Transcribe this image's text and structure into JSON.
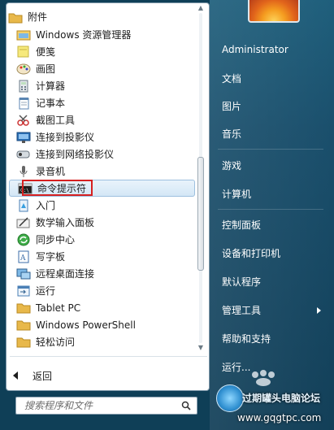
{
  "left_menu": {
    "items": [
      {
        "label": "附件",
        "icon": "folder-open-icon",
        "indent": false
      },
      {
        "label": "Windows 资源管理器",
        "icon": "explorer-icon",
        "indent": true
      },
      {
        "label": "便笺",
        "icon": "sticky-notes-icon",
        "indent": true
      },
      {
        "label": "画图",
        "icon": "paint-icon",
        "indent": true
      },
      {
        "label": "计算器",
        "icon": "calculator-icon",
        "indent": true
      },
      {
        "label": "记事本",
        "icon": "notepad-icon",
        "indent": true
      },
      {
        "label": "截图工具",
        "icon": "snipping-tool-icon",
        "indent": true
      },
      {
        "label": "连接到投影仪",
        "icon": "projector-icon",
        "indent": true
      },
      {
        "label": "连接到网络投影仪",
        "icon": "network-projector-icon",
        "indent": true
      },
      {
        "label": "录音机",
        "icon": "microphone-icon",
        "indent": true
      },
      {
        "label": "命令提示符",
        "icon": "cmd-icon",
        "indent": true,
        "selected": true
      },
      {
        "label": "入门",
        "icon": "getting-started-icon",
        "indent": true
      },
      {
        "label": "数学输入面板",
        "icon": "math-input-icon",
        "indent": true
      },
      {
        "label": "同步中心",
        "icon": "sync-center-icon",
        "indent": true
      },
      {
        "label": "写字板",
        "icon": "wordpad-icon",
        "indent": true
      },
      {
        "label": "远程桌面连接",
        "icon": "remote-desktop-icon",
        "indent": true
      },
      {
        "label": "运行",
        "icon": "run-icon",
        "indent": true
      },
      {
        "label": "Tablet PC",
        "icon": "folder-icon",
        "indent": true
      },
      {
        "label": "Windows PowerShell",
        "icon": "folder-icon",
        "indent": true
      },
      {
        "label": "轻松访问",
        "icon": "folder-icon",
        "indent": true
      }
    ],
    "back_label": "返回",
    "search_placeholder": "搜索程序和文件"
  },
  "right_menu": {
    "user_name": "Administrator",
    "items": [
      {
        "label": "文档"
      },
      {
        "label": "图片"
      },
      {
        "label": "音乐"
      },
      {
        "label": "游戏"
      },
      {
        "label": "计算机"
      },
      {
        "label": "控制面板"
      },
      {
        "label": "设备和打印机"
      },
      {
        "label": "默认程序"
      },
      {
        "label": "管理工具",
        "has_submenu": true
      },
      {
        "label": "帮助和支持"
      },
      {
        "label": "运行..."
      }
    ]
  },
  "watermark": {
    "title": "过期罐头电脑论坛",
    "url": "www.gqgtpc.com"
  },
  "colors": {
    "highlight_border": "#d62020",
    "right_pane": "#1a4f6c",
    "selected_bg": "#d4e7f6"
  }
}
